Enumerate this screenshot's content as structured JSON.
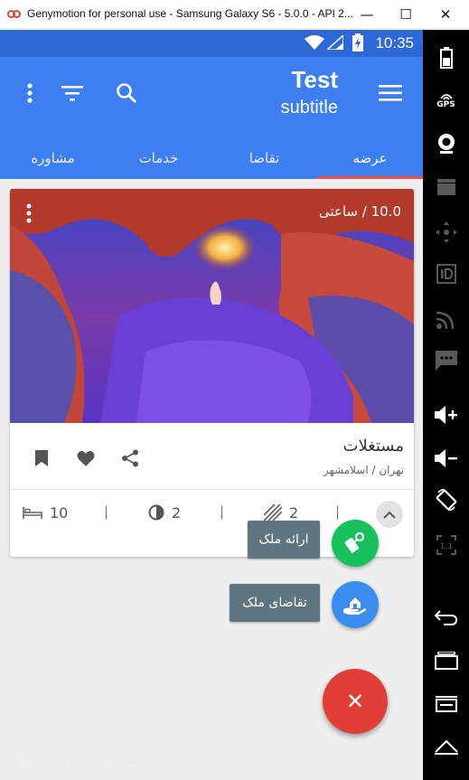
{
  "window": {
    "title": "Genymotion for personal use - Samsung Galaxy S6 - 5.0.0 - API 2...",
    "minimize_glyph": "—",
    "maximize_glyph": "☐",
    "close_glyph": "✕"
  },
  "status_bar": {
    "time": "10:35",
    "color": "#2e67d6"
  },
  "app_bar": {
    "title": "Test",
    "subtitle": "subtitle",
    "color": "#3d7ff0",
    "icons": [
      "menu-icon",
      "overflow-icon",
      "filter-icon",
      "search-icon"
    ]
  },
  "tabs": [
    {
      "label": "عرضه",
      "active": true
    },
    {
      "label": "تقاضا",
      "active": false
    },
    {
      "label": "خدمات",
      "active": false
    },
    {
      "label": "مشاوره",
      "active": false
    }
  ],
  "card": {
    "price": "10.0 / ساعتی",
    "title": "مستغلات",
    "location": "تهران / اسلامشهر",
    "actions": [
      "bookmark-icon",
      "heart-icon",
      "share-icon"
    ],
    "stats": {
      "beds": "10",
      "floor": "2",
      "parking": "2"
    },
    "separator": "|"
  },
  "speed_dial": {
    "offer_label": "ارائه ملک",
    "request_label": "تقاضای ملک",
    "main_fab_glyph": "✕",
    "offer_color": "#16c15e",
    "request_color": "#3a8dee",
    "main_color": "#e03e36"
  },
  "watermark": "free for personal use",
  "side_panel": {
    "gps_text": "GPS",
    "icons": [
      "battery-icon",
      "gps-icon",
      "camera-icon",
      "video-icon",
      "dpad-icon",
      "id-icon",
      "cast-icon",
      "sms-icon",
      "volume-up-icon",
      "volume-down-icon",
      "rotate-icon",
      "scale-icon",
      "back-icon",
      "recent-apps-icon",
      "menu-icon",
      "home-icon"
    ]
  }
}
